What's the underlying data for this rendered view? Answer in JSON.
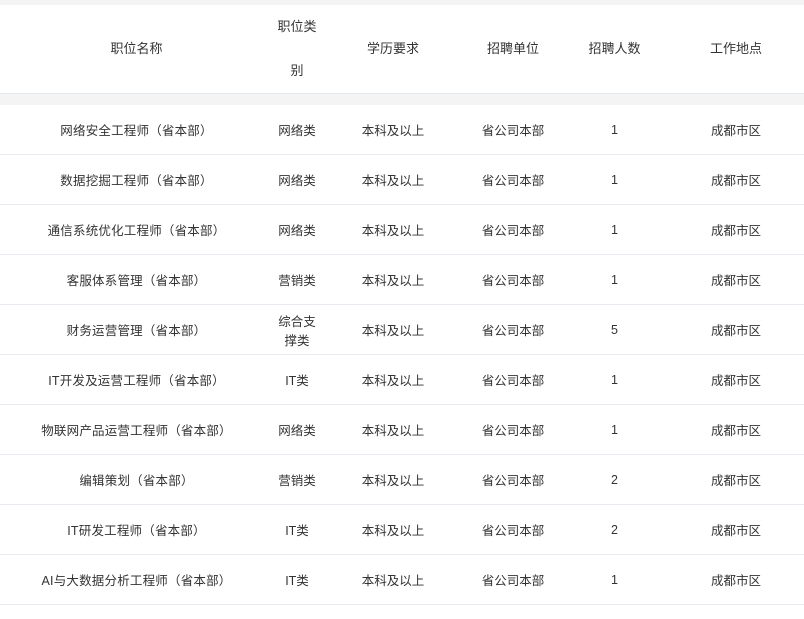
{
  "table": {
    "name": "recruitment-position-table",
    "columns": [
      {
        "key": "position_name",
        "label": "职位名称"
      },
      {
        "key": "position_category",
        "label": "职位类别"
      },
      {
        "key": "education",
        "label": "学历要求"
      },
      {
        "key": "recruiting_unit",
        "label": "招聘单位"
      },
      {
        "key": "headcount",
        "label": "招聘人数"
      },
      {
        "key": "work_location",
        "label": "工作地点"
      }
    ],
    "rows": [
      {
        "position_name": "网络安全工程师（省本部）",
        "position_category": "网络类",
        "education": "本科及以上",
        "recruiting_unit": "省公司本部",
        "headcount": "1",
        "work_location": "成都市区"
      },
      {
        "position_name": "数据挖掘工程师（省本部）",
        "position_category": "网络类",
        "education": "本科及以上",
        "recruiting_unit": "省公司本部",
        "headcount": "1",
        "work_location": "成都市区"
      },
      {
        "position_name": "通信系统优化工程师（省本部）",
        "position_category": "网络类",
        "education": "本科及以上",
        "recruiting_unit": "省公司本部",
        "headcount": "1",
        "work_location": "成都市区"
      },
      {
        "position_name": "客服体系管理（省本部）",
        "position_category": "营销类",
        "education": "本科及以上",
        "recruiting_unit": "省公司本部",
        "headcount": "1",
        "work_location": "成都市区"
      },
      {
        "position_name": "财务运营管理（省本部）",
        "position_category": "综合支撑类",
        "education": "本科及以上",
        "recruiting_unit": "省公司本部",
        "headcount": "5",
        "work_location": "成都市区"
      },
      {
        "position_name": "IT开发及运营工程师（省本部）",
        "position_category": "IT类",
        "education": "本科及以上",
        "recruiting_unit": "省公司本部",
        "headcount": "1",
        "work_location": "成都市区"
      },
      {
        "position_name": "物联网产品运营工程师（省本部）",
        "position_category": "网络类",
        "education": "本科及以上",
        "recruiting_unit": "省公司本部",
        "headcount": "1",
        "work_location": "成都市区"
      },
      {
        "position_name": "编辑策划（省本部）",
        "position_category": "营销类",
        "education": "本科及以上",
        "recruiting_unit": "省公司本部",
        "headcount": "2",
        "work_location": "成都市区"
      },
      {
        "position_name": "IT研发工程师（省本部）",
        "position_category": "IT类",
        "education": "本科及以上",
        "recruiting_unit": "省公司本部",
        "headcount": "2",
        "work_location": "成都市区"
      },
      {
        "position_name": "AI与大数据分析工程师（省本部）",
        "position_category": "IT类",
        "education": "本科及以上",
        "recruiting_unit": "省公司本部",
        "headcount": "1",
        "work_location": "成都市区"
      }
    ]
  },
  "colors": {
    "text": "#333333",
    "header_background": "#ffffff",
    "band_background": "#f4f4f5",
    "row_divider": "#e8ecf0",
    "band_divider": "#e3e8ee"
  }
}
